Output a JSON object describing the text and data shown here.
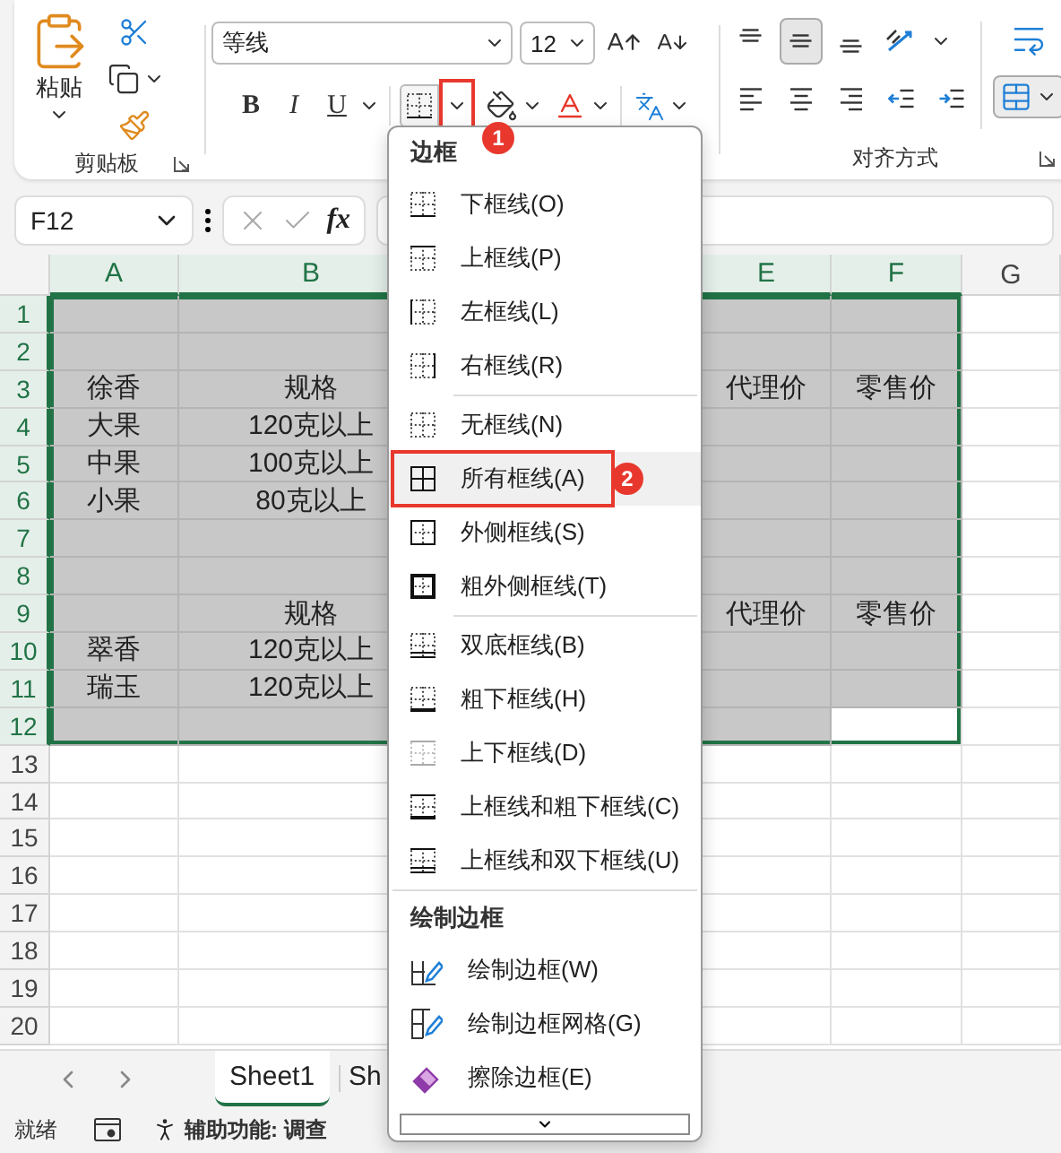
{
  "ribbon": {
    "clipboard": {
      "paste_label": "粘贴",
      "group_label": "剪贴板"
    },
    "font": {
      "font_name": "等线",
      "font_size": "12",
      "style_buttons": [
        {
          "kind": "bold",
          "label": "B"
        },
        {
          "kind": "italic",
          "label": "I"
        },
        {
          "kind": "underline",
          "label": "U"
        }
      ],
      "borders_dropdown": {
        "callout": "1"
      }
    },
    "alignment": {
      "group_label": "对齐方式",
      "vertical": [
        {
          "kind": "top",
          "selected": false
        },
        {
          "kind": "middle",
          "selected": true
        },
        {
          "kind": "bottom",
          "selected": false
        }
      ]
    }
  },
  "formula_bar": {
    "name_box": "F12",
    "fx": "fx"
  },
  "grid": {
    "columns": [
      {
        "label": "A",
        "selected": true
      },
      {
        "label": "B",
        "selected": true
      },
      null,
      null,
      {
        "label": "E",
        "selected": true
      },
      {
        "label": "F",
        "selected": true
      },
      {
        "label": "G",
        "selected": false
      }
    ],
    "rows": [
      {
        "label": "1",
        "selected": true
      },
      {
        "label": "2",
        "selected": true
      },
      {
        "label": "3",
        "selected": true,
        "cells": [
          {
            "text": "徐香"
          },
          {
            "text": "规格"
          },
          null,
          null,
          {
            "text": "代理价"
          },
          {
            "text": "零售价"
          },
          null
        ]
      },
      {
        "label": "4",
        "selected": true,
        "cells": [
          {
            "text": "大果"
          },
          {
            "text": "120克以上"
          },
          null,
          null,
          null,
          null,
          null
        ]
      },
      {
        "label": "5",
        "selected": true,
        "cells": [
          {
            "text": "中果"
          },
          {
            "text": "100克以上"
          },
          null,
          null,
          null,
          null,
          null
        ]
      },
      {
        "label": "6",
        "selected": true,
        "cells": [
          {
            "text": "小果"
          },
          {
            "text": "80克以上"
          },
          null,
          null,
          null,
          null,
          null
        ]
      },
      {
        "label": "7",
        "selected": true
      },
      {
        "label": "8",
        "selected": true
      },
      {
        "label": "9",
        "selected": true,
        "cells": [
          null,
          {
            "text": "规格"
          },
          null,
          null,
          {
            "text": "代理价"
          },
          {
            "text": "零售价"
          },
          null
        ]
      },
      {
        "label": "10",
        "selected": true,
        "cells": [
          {
            "text": "翠香"
          },
          {
            "text": "120克以上"
          },
          null,
          null,
          null,
          null,
          null
        ]
      },
      {
        "label": "11",
        "selected": true,
        "cells": [
          {
            "text": "瑞玉"
          },
          {
            "text": "120克以上"
          },
          null,
          null,
          null,
          null,
          null
        ]
      },
      {
        "label": "12",
        "selected": true,
        "cells": [
          null,
          null,
          null,
          null,
          null,
          {
            "active": true
          },
          null
        ]
      },
      {
        "label": "13",
        "selected": false
      },
      {
        "label": "14",
        "selected": false
      },
      {
        "label": "15",
        "selected": false
      },
      {
        "label": "16",
        "selected": false
      },
      {
        "label": "17",
        "selected": false
      },
      {
        "label": "18",
        "selected": false
      },
      {
        "label": "19",
        "selected": false
      },
      {
        "label": "20",
        "selected": false
      }
    ]
  },
  "sheet_tabs": [
    {
      "label": "Sheet1",
      "selected": true
    },
    {
      "label": "Sh",
      "selected": false
    }
  ],
  "status_bar": {
    "ready": "就绪",
    "accessibility": "辅助功能: 调查"
  },
  "border_menu": {
    "sections": [
      {
        "title": "边框",
        "groups": [
          [
            {
              "kind": "bottom",
              "label": "下框线(O)",
              "selected": false
            },
            {
              "kind": "top",
              "label": "上框线(P)",
              "selected": false
            },
            {
              "kind": "left",
              "label": "左框线(L)",
              "selected": false
            },
            {
              "kind": "right",
              "label": "右框线(R)",
              "selected": false
            }
          ],
          [
            {
              "kind": "none",
              "label": "无框线(N)",
              "selected": false
            },
            {
              "kind": "all",
              "label": "所有框线(A)",
              "selected": true,
              "callout": "2"
            },
            {
              "kind": "outside",
              "label": "外侧框线(S)",
              "selected": false
            },
            {
              "kind": "thick_outside",
              "label": "粗外侧框线(T)",
              "selected": false
            }
          ],
          [
            {
              "kind": "double_bottom",
              "label": "双底框线(B)",
              "selected": false
            },
            {
              "kind": "thick_bottom",
              "label": "粗下框线(H)",
              "selected": false
            },
            {
              "kind": "top_bottom",
              "label": "上下框线(D)",
              "selected": false
            },
            {
              "kind": "top_thick_bottom",
              "label": "上框线和粗下框线(C)",
              "selected": false
            },
            {
              "kind": "top_double_bottom",
              "label": "上框线和双下框线(U)",
              "selected": false
            }
          ]
        ]
      },
      {
        "title": "绘制边框",
        "groups": [
          [
            {
              "kind": "draw",
              "label": "绘制边框(W)",
              "selected": false
            },
            {
              "kind": "draw_grid",
              "label": "绘制边框网格(G)",
              "selected": false
            },
            {
              "kind": "erase",
              "label": "擦除边框(E)",
              "selected": false
            }
          ]
        ]
      }
    ]
  }
}
